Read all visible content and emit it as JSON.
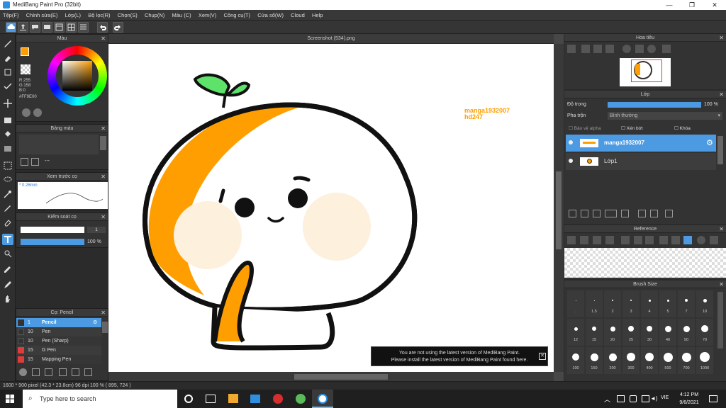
{
  "window": {
    "title": "MediBang Paint Pro (32bit)",
    "minimize_glyph": "—",
    "maximize_glyph": "❐",
    "close_glyph": "✕"
  },
  "menu": [
    "Tệp(F)",
    "Chỉnh sửa(E)",
    "Lớp(L)",
    "Bộ lọc(R)",
    "Chọn(S)",
    "Chụp(N)",
    "Màu (C)",
    "Xem(V)",
    "Công cụ(T)",
    "Cửa sổ(W)",
    "Cloud",
    "Help"
  ],
  "colors": {
    "accent": "#4c9be2",
    "primary_color": "#FF9E00",
    "secondary_color": "#000000",
    "panel_bg": "#333333"
  },
  "color_panel": {
    "title": "Màu",
    "r": "R:255",
    "g": "G:158",
    "b": "B:0",
    "hex": "#FF9E00"
  },
  "palette_panel": {
    "title": "Bảng màu",
    "entry": "---"
  },
  "brush_preview": {
    "title": "Xem trước cọ",
    "size": "* 0.26mm"
  },
  "brush_control": {
    "title": "Kiểm soát cọ",
    "size_value": "1",
    "opacity_value": "100 %"
  },
  "brush_list": {
    "title": "Cọ: Pencil",
    "items": [
      {
        "size": "1",
        "name": "Pencil",
        "color": "#333333",
        "active": true
      },
      {
        "size": "10",
        "name": "Pen",
        "color": "#333333"
      },
      {
        "size": "10",
        "name": "Pen (Sharp)",
        "color": "#333333"
      },
      {
        "size": "15",
        "name": "G Pen",
        "color": "#e03b3b"
      },
      {
        "size": "15",
        "name": "Mapping Pen",
        "color": "#e03b3b"
      }
    ]
  },
  "canvas": {
    "tab_title": "Screenshot (534).png",
    "watermark_line1": "manga1932007",
    "watermark_line2": "hd247"
  },
  "navigator": {
    "title": "Hoa tiêu"
  },
  "layers": {
    "title": "Lớp",
    "opacity_label": "Độ trong",
    "opacity_value": "100 %",
    "blend_label": "Pha trộn",
    "blend_value": "Bình thường",
    "protect_alpha": "Bảo vệ alpha",
    "clipping": "Xén bớt",
    "lock": "Khóa",
    "items": [
      {
        "name": "manga1932007",
        "active": true
      },
      {
        "name": "Lớp1",
        "active": false
      }
    ]
  },
  "reference": {
    "title": "Reference"
  },
  "brush_size": {
    "title": "Brush Size",
    "rows": [
      [
        ".",
        "1.5",
        "2",
        "3",
        "4",
        "5",
        "7",
        "10"
      ],
      [
        "12",
        "15",
        "20",
        "25",
        "30",
        "40",
        "50",
        "70"
      ],
      [
        "100",
        "150",
        "200",
        "300",
        "400",
        "500",
        "700",
        "1000"
      ]
    ]
  },
  "notification": {
    "line1": "You are not using the latest version of MediBang Paint.",
    "line2": "Please install the latest version of MediBang Paint found here."
  },
  "status": {
    "text": "1600 * 900 pixel  (42.3 * 23.8cm)  96 dpi  100 %  ( 895, 724 )"
  },
  "taskbar": {
    "search_placeholder": "Type here to search",
    "language": "VIE",
    "time": "4:12 PM",
    "date": "9/6/2021"
  }
}
